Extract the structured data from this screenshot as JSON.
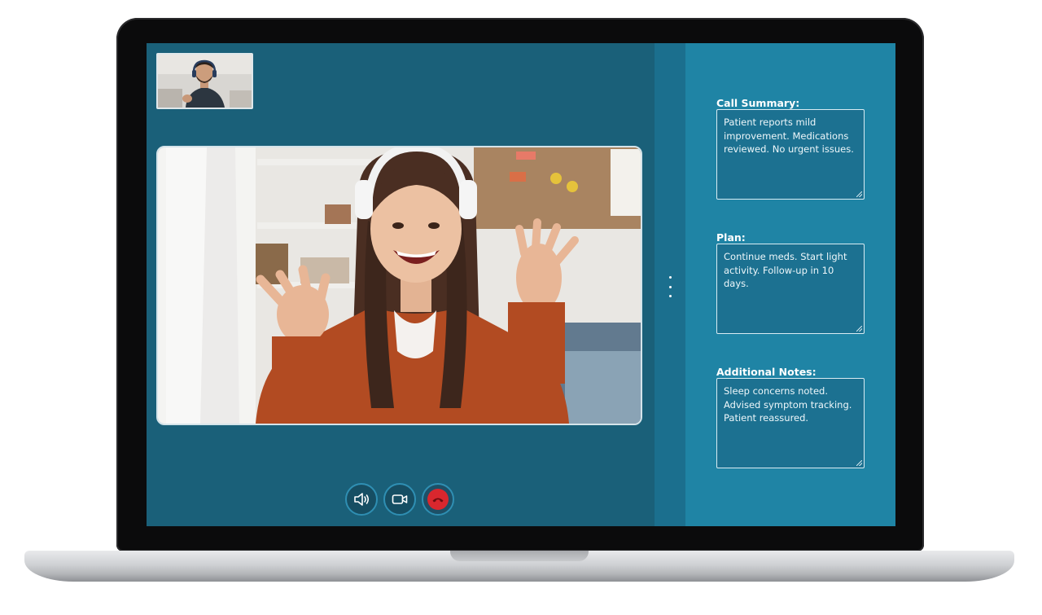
{
  "call": {
    "self_view_alt": "Doctor self view",
    "main_video_alt": "Patient video"
  },
  "controls": {
    "speaker_icon": "speaker-icon",
    "camera_icon": "video-camera-icon",
    "end_call_icon": "phone-hangup-icon"
  },
  "notes": {
    "call_summary": {
      "label": "Call Summary:",
      "text": "Patient reports mild improvement. Medications reviewed. No urgent issues."
    },
    "plan": {
      "label": "Plan:",
      "text": "Continue meds. Start light activity. Follow-up in 10 days."
    },
    "additional_notes": {
      "label": "Additional Notes:",
      "text": "Sleep concerns noted. Advised symptom tracking. Patient reassured."
    }
  },
  "colors": {
    "call_background": "#1a6079",
    "notes_background": "#1f84a5",
    "end_call": "#d9272e"
  }
}
